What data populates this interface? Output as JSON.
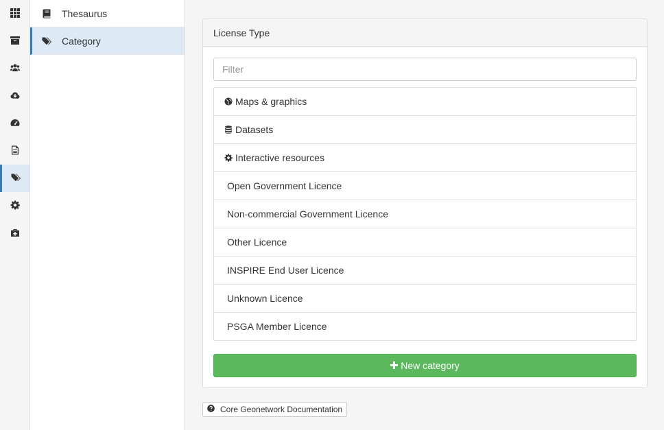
{
  "rail": {
    "items": [
      {
        "icon": "grid-icon"
      },
      {
        "icon": "archive-icon"
      },
      {
        "icon": "users-icon"
      },
      {
        "icon": "cloud-download-icon"
      },
      {
        "icon": "dashboard-icon"
      },
      {
        "icon": "file-text-icon"
      },
      {
        "icon": "tags-icon",
        "active": true
      },
      {
        "icon": "gear-icon"
      },
      {
        "icon": "medkit-icon"
      }
    ]
  },
  "subnav": {
    "items": [
      {
        "label": "Thesaurus",
        "icon": "book-icon"
      },
      {
        "label": "Category",
        "icon": "tags-icon",
        "active": true
      }
    ]
  },
  "panel": {
    "title": "License Type",
    "filter_placeholder": "Filter",
    "filter_value": "",
    "categories": [
      {
        "label": "Maps & graphics",
        "icon": "globe-icon"
      },
      {
        "label": "Datasets",
        "icon": "database-icon"
      },
      {
        "label": "Interactive resources",
        "icon": "gear-icon"
      },
      {
        "label": "Open Government Licence"
      },
      {
        "label": "Non-commercial Government Licence"
      },
      {
        "label": "Other Licence"
      },
      {
        "label": "INSPIRE End User Licence"
      },
      {
        "label": "Unknown Licence"
      },
      {
        "label": "PSGA Member Licence"
      }
    ],
    "new_button_label": "New category"
  },
  "footer": {
    "doc_button_label": "Core Geonetwork Documentation"
  },
  "colors": {
    "accent": "#337ab7",
    "active_bg": "#dde9f5",
    "success": "#5cb85c"
  }
}
